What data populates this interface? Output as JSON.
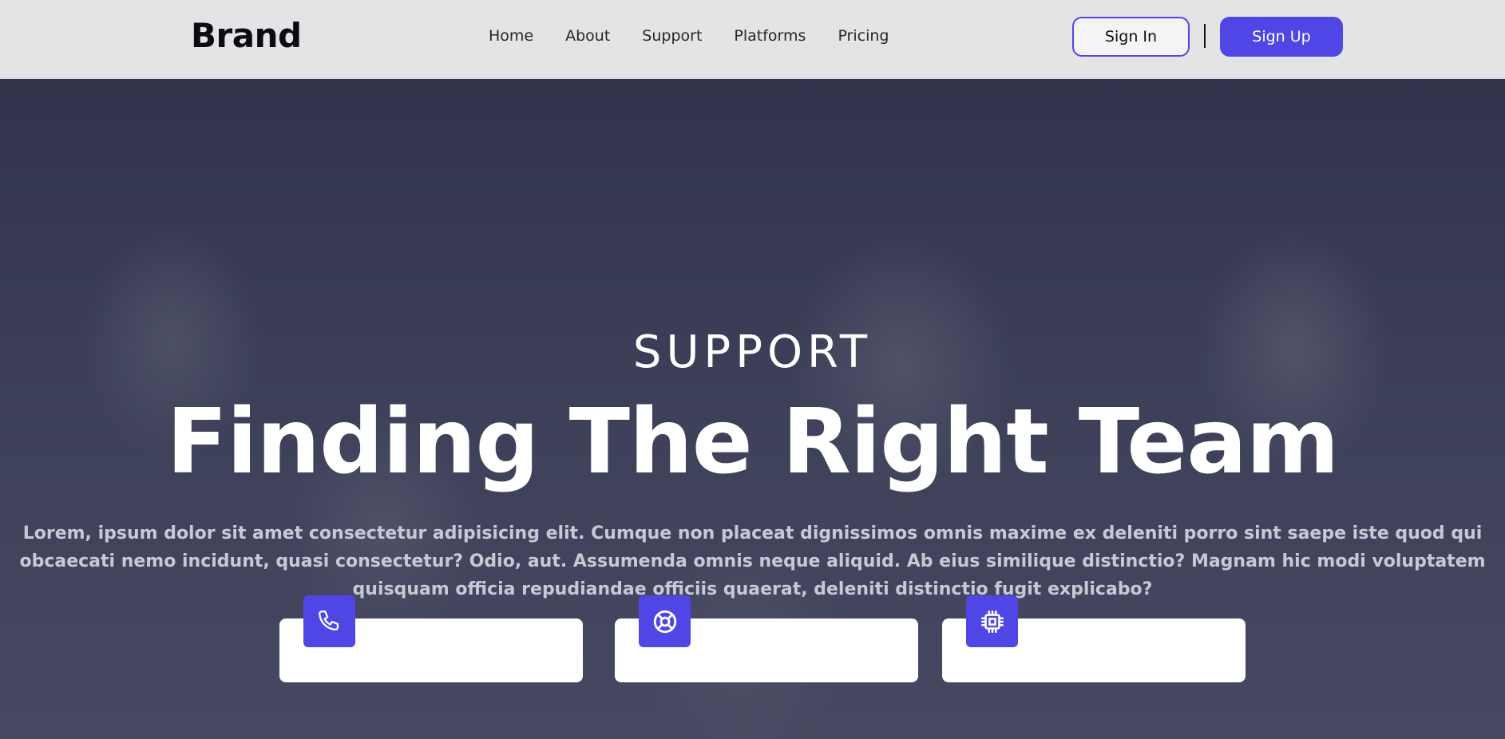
{
  "navbar": {
    "brand": "Brand",
    "links": [
      "Home",
      "About",
      "Support",
      "Platforms",
      "Pricing"
    ],
    "sign_in": "Sign In",
    "sign_up": "Sign Up"
  },
  "hero": {
    "kicker": "SUPPORT",
    "title": "Finding The Right Team",
    "text": "Lorem, ipsum dolor sit amet consectetur adipisicing elit. Cumque non placeat dignissimos omnis maxime ex deleniti porro sint saepe iste quod qui obcaecati nemo incidunt, quasi consectetur? Odio, aut. Assumenda omnis neque aliquid. Ab eius similique distinctio? Magnam hic modi voluptatem quisquam officia repudiandae officiis quaerat, deleniti distinctio fugit explicabo?"
  },
  "features": [
    {
      "icon": "phone-icon"
    },
    {
      "icon": "lifebuoy-icon"
    },
    {
      "icon": "cpu-chip-icon"
    }
  ],
  "colors": {
    "accent": "#4f46e5",
    "navbar_bg": "#e4e4e7",
    "hero_overlay": "#282a44"
  }
}
